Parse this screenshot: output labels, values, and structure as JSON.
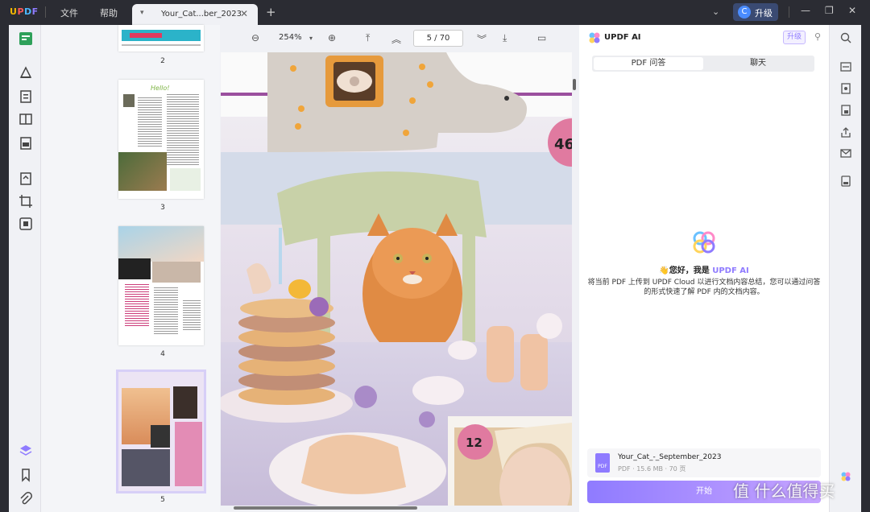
{
  "titlebar": {
    "logo": "UPDF",
    "menu_file": "文件",
    "menu_help": "帮助",
    "tab_name": "Your_Cat...ber_2023",
    "upgrade_letter": "C",
    "upgrade_label": "升级"
  },
  "toolbar": {
    "zoom": "254%",
    "page_current": "5",
    "page_sep": "/",
    "page_total": "70"
  },
  "thumbnails": {
    "pages": [
      "2",
      "3",
      "4",
      "5"
    ]
  },
  "page_content": {
    "badge_top": "46",
    "badge_bottom": "12"
  },
  "ai": {
    "title": "UPDF AI",
    "upgrade": "升级",
    "tab_pdf": "PDF 问答",
    "tab_chat": "聊天",
    "greeting_prefix": "您好，我是",
    "greeting_brand": "UPDF AI",
    "description": "将当前 PDF 上传到 UPDF Cloud 以进行文档内容总结，您可以通过问答的形式快速了解 PDF 内的文档内容。",
    "file_name": "Your_Cat_-_September_2023",
    "file_meta": "PDF · 15.6 MB · 70 页",
    "file_icon_label": "PDF",
    "start_button": "开始"
  },
  "watermark": "值 什么值得买",
  "colors": {
    "accent": "#8f7bff",
    "badge_pink": "#e07aa0",
    "titlebar": "#2b2c33"
  }
}
